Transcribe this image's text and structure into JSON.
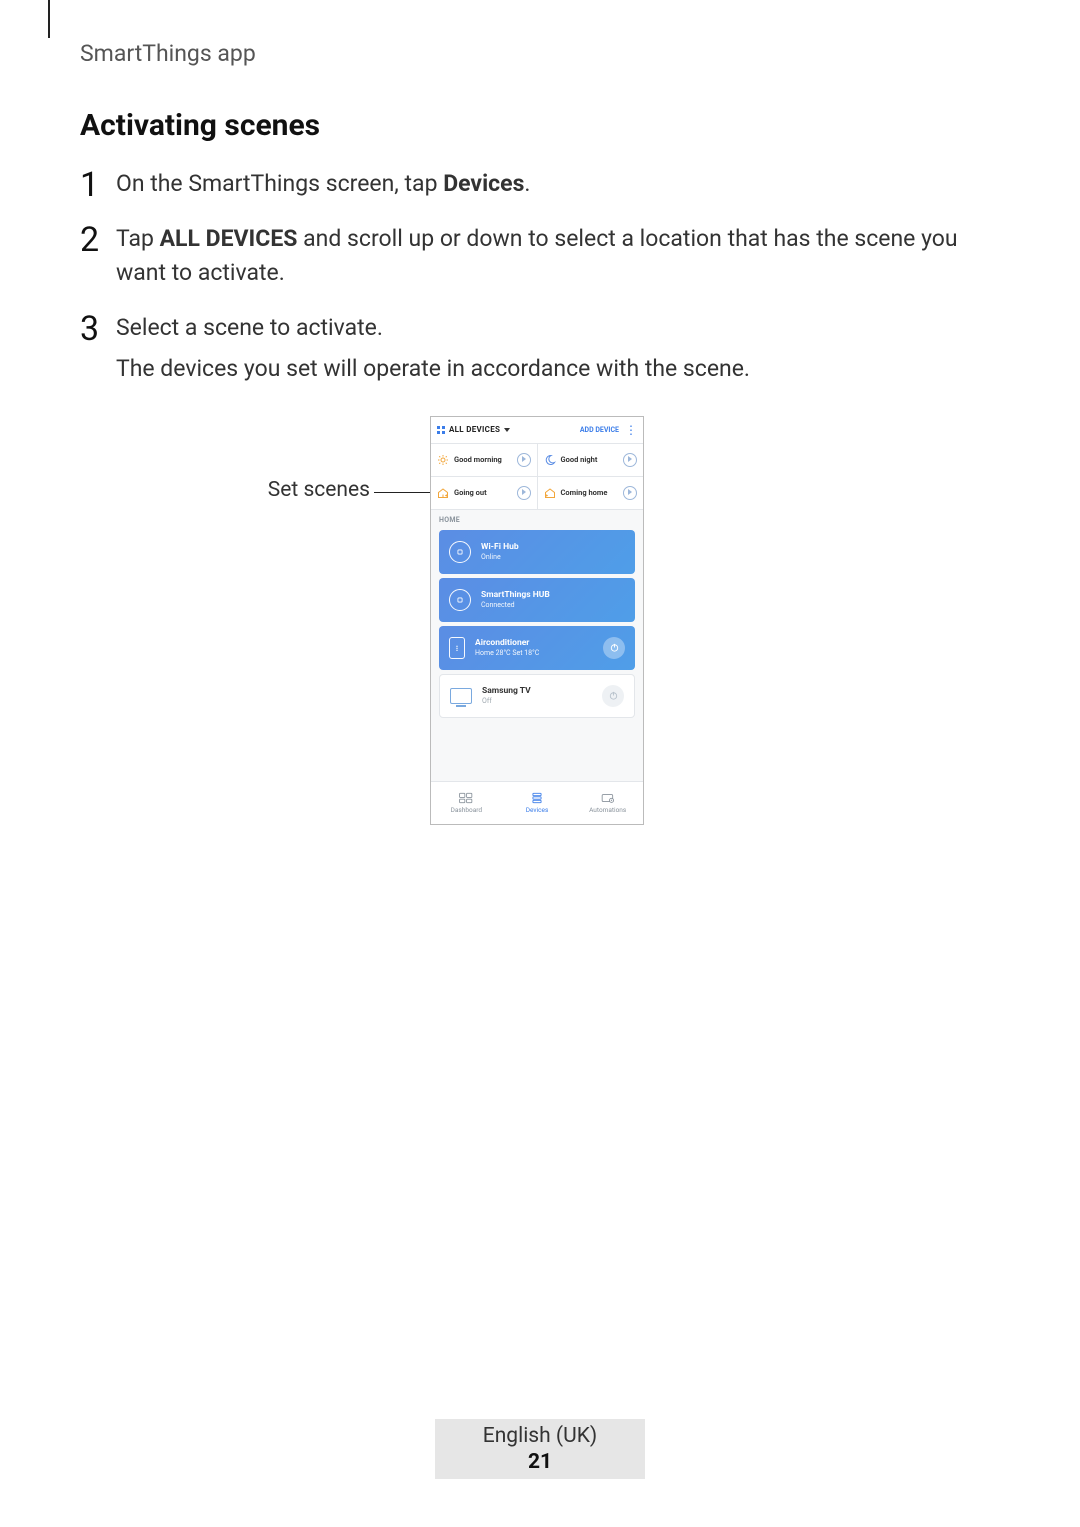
{
  "running_head": "SmartThings app",
  "section_title": "Activating scenes",
  "steps": {
    "s1_pre": "On the SmartThings screen, tap ",
    "s1_bold": "Devices",
    "s1_post": ".",
    "s2_pre": "Tap ",
    "s2_bold": "ALL DEVICES",
    "s2_post": " and scroll up or down to select a location that has the scene you want to activate.",
    "s3_a": "Select a scene to activate.",
    "s3_b": "The devices you set will operate in accordance with the scene."
  },
  "callout": {
    "set_scenes": "Set scenes"
  },
  "phone": {
    "header": {
      "title": "ALL DEVICES",
      "add_device": "ADD DEVICE"
    },
    "scenes": [
      {
        "label": "Good morning"
      },
      {
        "label": "Good night"
      },
      {
        "label": "Going out"
      },
      {
        "label": "Coming home"
      }
    ],
    "section_label": "HOME",
    "devices": [
      {
        "title": "Wi-Fi Hub",
        "sub": "Online"
      },
      {
        "title": "SmartThings HUB",
        "sub": "Connected"
      },
      {
        "title": "Airconditioner",
        "sub": "Home 28°C  Set 18°C"
      },
      {
        "title": "Samsung TV",
        "sub": "Off"
      }
    ],
    "nav": {
      "dashboard": "Dashboard",
      "devices": "Devices",
      "automations": "Automations"
    }
  },
  "footer": {
    "lang": "English (UK)",
    "page": "21"
  }
}
